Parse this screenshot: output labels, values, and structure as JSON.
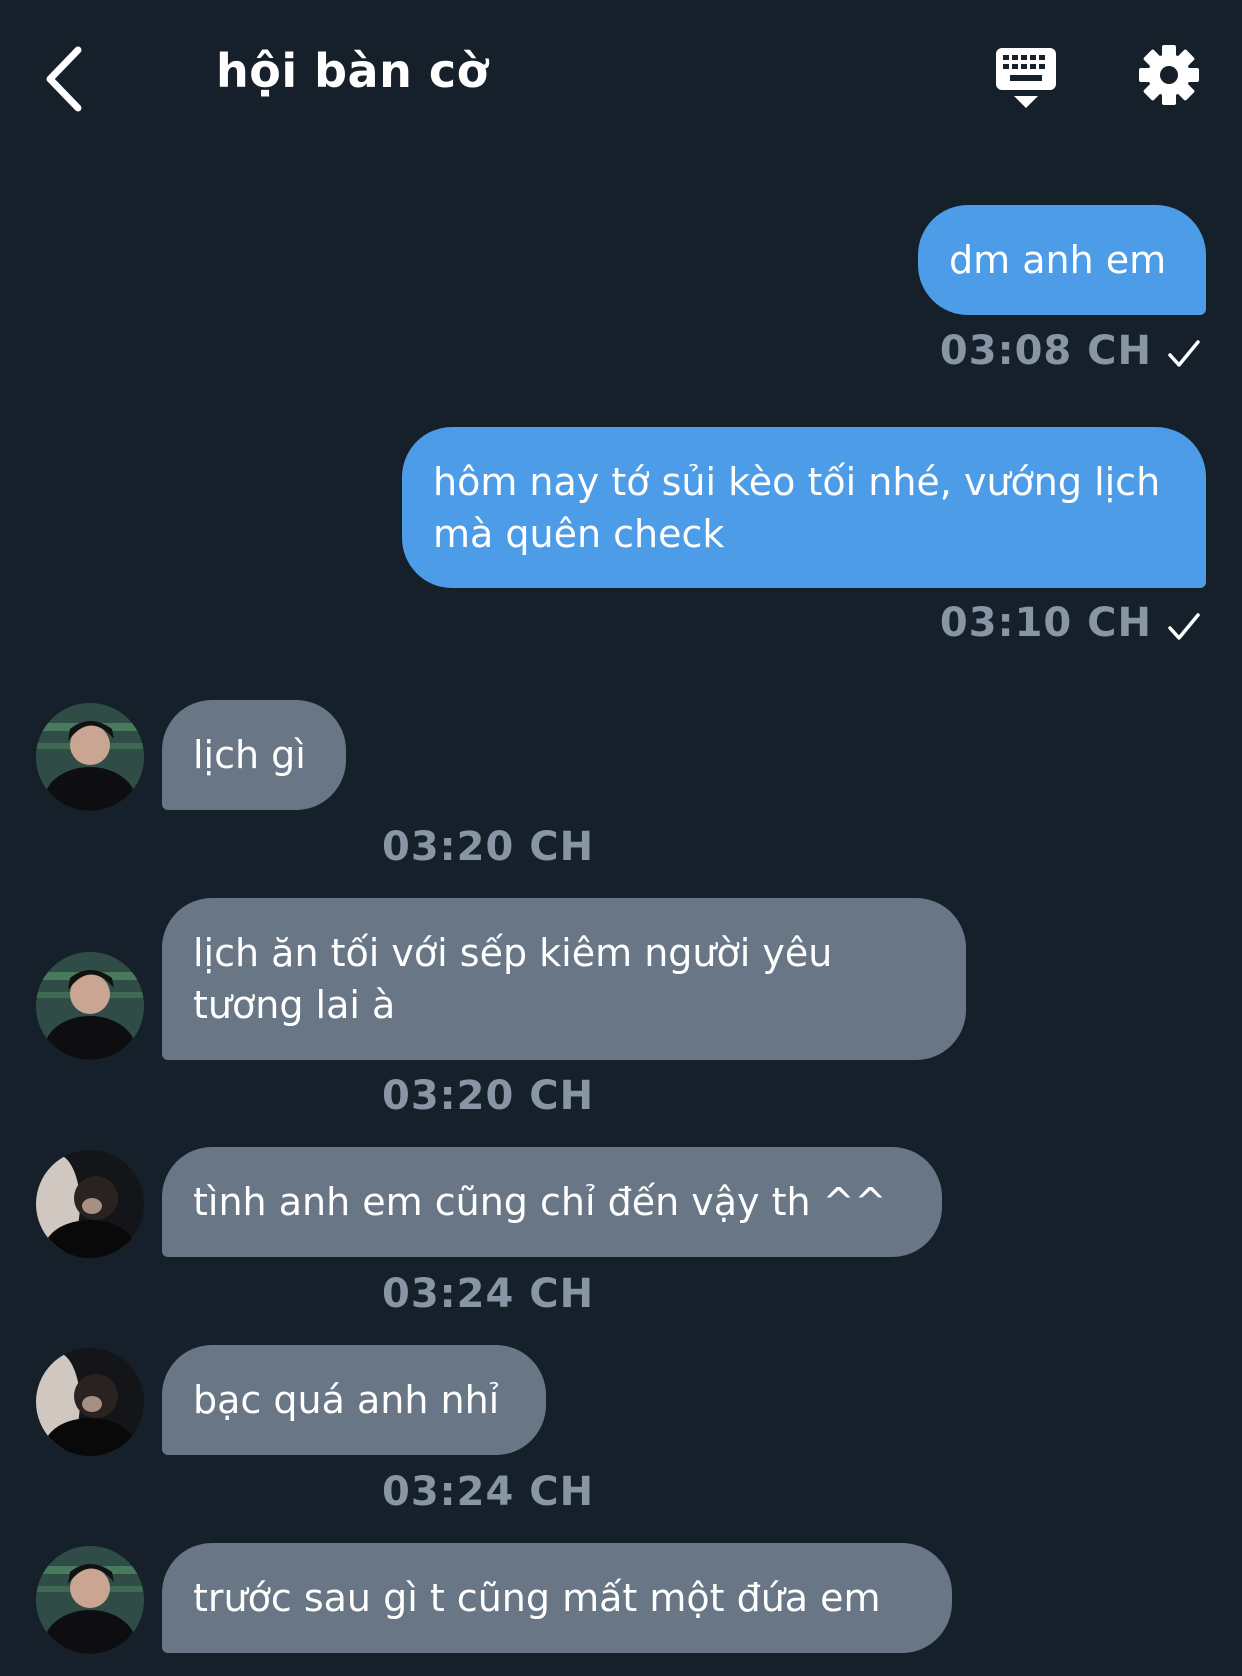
{
  "header": {
    "title": "hội bàn cờ",
    "icons": [
      "back-chevron-icon",
      "keyboard-icon",
      "gear-icon"
    ]
  },
  "messages": [
    {
      "direction": "out",
      "text": "dm anh em",
      "time": "03:08 CH",
      "read": true
    },
    {
      "direction": "out",
      "text": "hôm nay tớ sủi kèo tối nhé, vướng lịch mà quên check",
      "time": "03:10 CH",
      "read": true
    },
    {
      "direction": "in",
      "text": "lịch gì",
      "time": "03:20 CH"
    },
    {
      "direction": "in",
      "text": "lịch ăn tối với sếp kiêm người yêu tương lai à",
      "time": "03:20 CH"
    },
    {
      "direction": "in",
      "text": "tình anh em cũng chỉ đến vậy th ^^",
      "time": "03:24 CH"
    },
    {
      "direction": "in",
      "text": "bạc quá anh nhỉ",
      "time": "03:24 CH"
    },
    {
      "direction": "in",
      "text": "trước sau gì t cũng mất một đứa em",
      "time": ""
    }
  ],
  "colors": {
    "background": "#16202b",
    "outgoing_bubble": "#4c9ce8",
    "incoming_bubble": "#687686",
    "timestamp": "#8795a5"
  }
}
